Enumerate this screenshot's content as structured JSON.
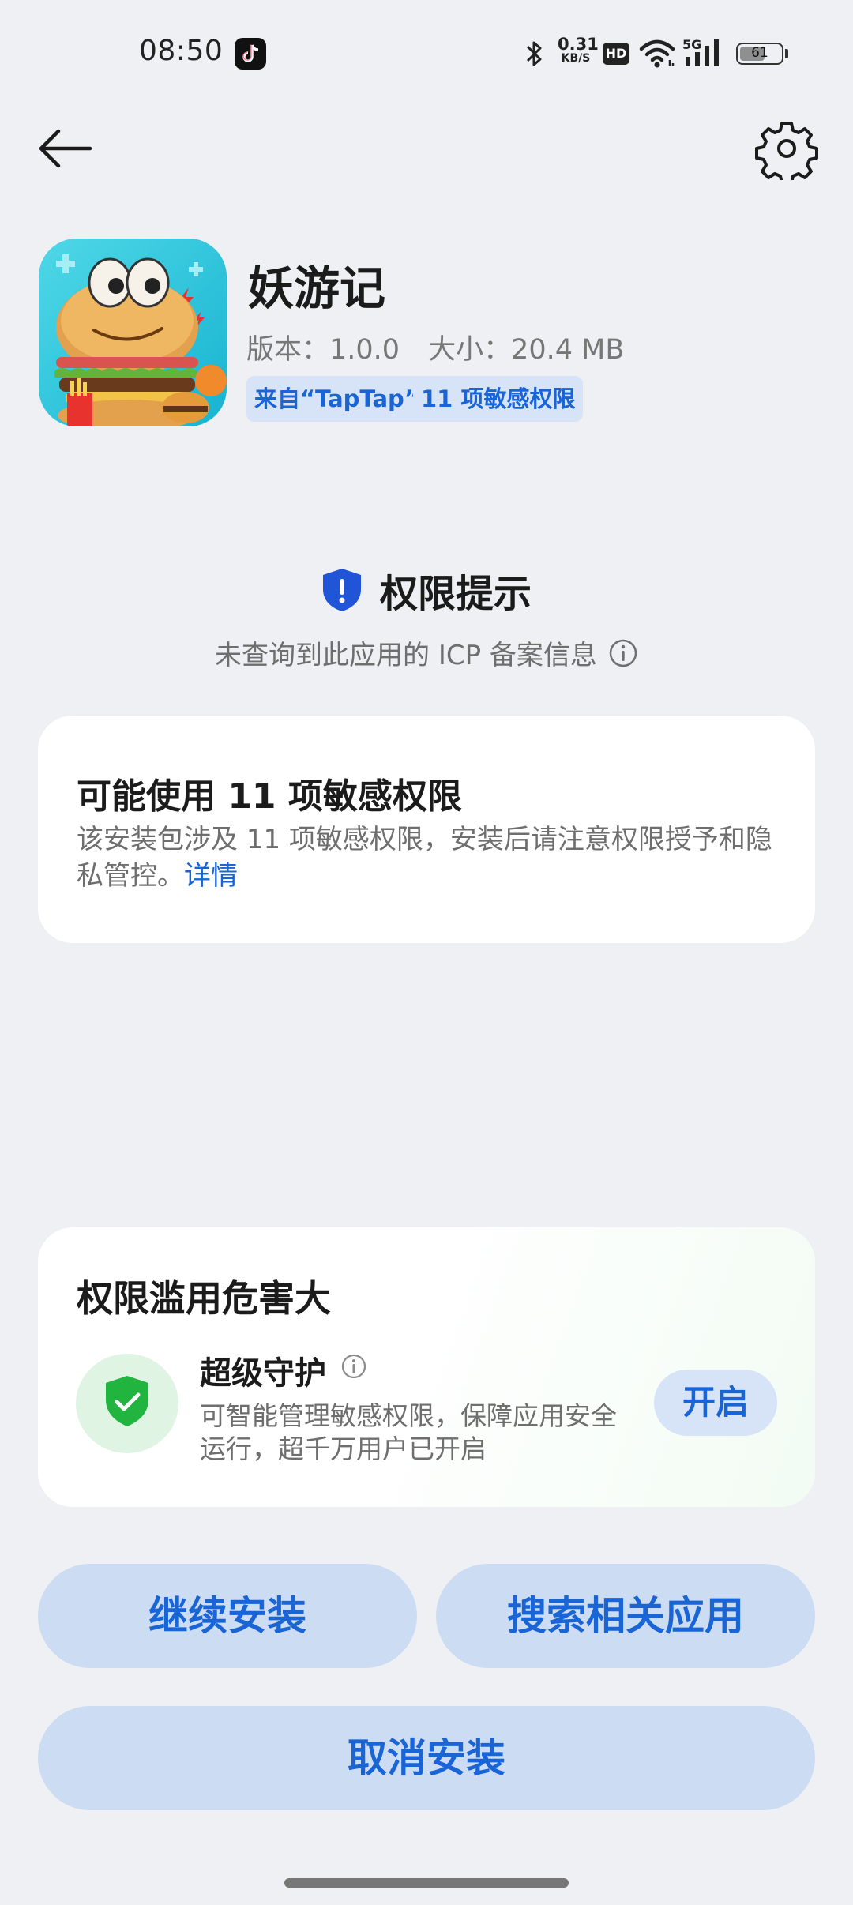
{
  "status_bar": {
    "time": "08:50",
    "net_speed_value": "0.31",
    "net_speed_unit": "KB/S",
    "hd_label": "HD",
    "signal_label": "5G",
    "battery_level": "61",
    "battery_fraction": 0.61,
    "icons": [
      "tiktok-icon",
      "bluetooth-icon",
      "wifi-icon",
      "signal-icon",
      "battery-icon"
    ]
  },
  "toolbar": {
    "back_icon": "back-arrow-icon",
    "settings_icon": "gear-icon"
  },
  "app": {
    "name": "妖游记",
    "version_label": "版本：1.0.0",
    "size_label": "大小：20.4 MB",
    "tags": [
      "来自“TapTap”",
      "11 项敏感权限"
    ]
  },
  "notice": {
    "title": "权限提示",
    "subtitle": "未查询到此应用的 ICP 备案信息",
    "shield_icon": "shield-alert-icon",
    "info_icon": "info-icon"
  },
  "permissions_card": {
    "title": "可能使用 11 项敏感权限",
    "body": "该安装包涉及 11 项敏感权限，安装后请注意权限授予和隐私管控。",
    "link": "详情"
  },
  "protection_card": {
    "title": "权限滥用危害大",
    "feature_title": "超级守护",
    "feature_desc": "可智能管理敏感权限，保障应用安全运行，超千万用户已开启",
    "enable_label": "开启",
    "shield_icon": "shield-check-icon"
  },
  "actions": {
    "continue_label": "继续安装",
    "search_label": "搜索相关应用",
    "cancel_label": "取消安装"
  },
  "colors": {
    "accent": "#1a65d6",
    "button_bg": "#ccdcf3",
    "tag_bg": "#d7e3f7",
    "page_bg": "#eff0f3",
    "success_green": "#21b53f"
  }
}
